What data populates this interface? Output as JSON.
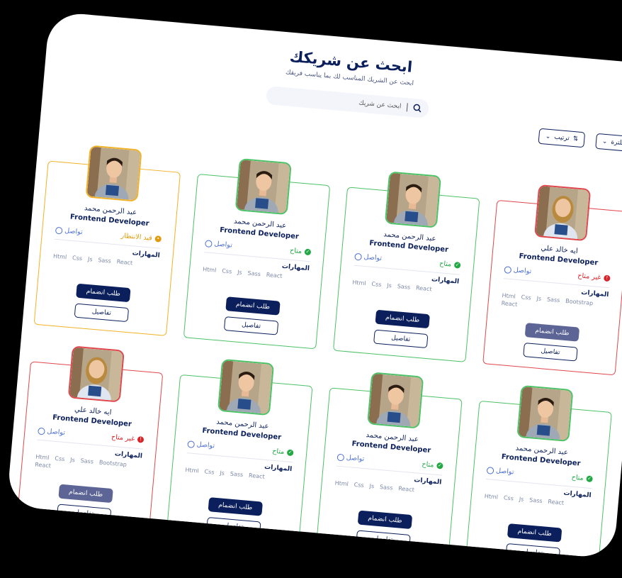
{
  "header": {
    "title": "ابحث عن شريكك",
    "subtitle": "ابحث عن الشريك المناسب لك بما يناسب فريقك"
  },
  "search": {
    "placeholder": "ابحث عن شريك",
    "icon": "search-icon"
  },
  "controls": {
    "filter_label": "فلترة",
    "sort_label": "ترتيب"
  },
  "labels": {
    "skills": "المهارات",
    "contact": "تواصل",
    "join": "طلب انضمام",
    "details": "تفاصيل"
  },
  "colors": {
    "navy": "#0b1f5c",
    "available": "#22a845",
    "unavailable": "#d8232a",
    "pending": "#e19b0c"
  },
  "cards": [
    {
      "name": "ايه خالد علي",
      "role": "Frontend Developer",
      "status": "غير متاح",
      "state": "unavailable",
      "skills": [
        "Html",
        "Css",
        "Js",
        "Sass",
        "Bootstrap",
        "React"
      ]
    },
    {
      "name": "عبد الرحمن محمد",
      "role": "Frontend Developer",
      "status": "متاح",
      "state": "available",
      "skills": [
        "Html",
        "Css",
        "Js",
        "Sass",
        "React"
      ]
    },
    {
      "name": "عبد الرحمن محمد",
      "role": "Frontend Developer",
      "status": "متاح",
      "state": "available",
      "skills": [
        "Html",
        "Css",
        "Js",
        "Sass",
        "React"
      ]
    },
    {
      "name": "عبد الرحمن محمد",
      "role": "Frontend Developer",
      "status": "قيد الانتظار",
      "state": "pending",
      "skills": [
        "Html",
        "Css",
        "Js",
        "Sass",
        "React"
      ]
    },
    {
      "name": "عبد الرحمن محمد",
      "role": "Frontend Developer",
      "status": "متاح",
      "state": "available",
      "skills": [
        "Html",
        "Css",
        "Js",
        "Sass",
        "React"
      ]
    },
    {
      "name": "عبد الرحمن محمد",
      "role": "Frontend Developer",
      "status": "متاح",
      "state": "available",
      "skills": [
        "Html",
        "Css",
        "Js",
        "Sass",
        "React"
      ]
    },
    {
      "name": "عبد الرحمن محمد",
      "role": "Frontend Developer",
      "status": "متاح",
      "state": "available",
      "skills": [
        "Html",
        "Css",
        "Js",
        "Sass",
        "React"
      ]
    },
    {
      "name": "ايه خالد علي",
      "role": "Frontend Developer",
      "status": "غير متاح",
      "state": "unavailable",
      "skills": [
        "Html",
        "Css",
        "Js",
        "Sass",
        "Bootstrap",
        "React"
      ]
    }
  ]
}
